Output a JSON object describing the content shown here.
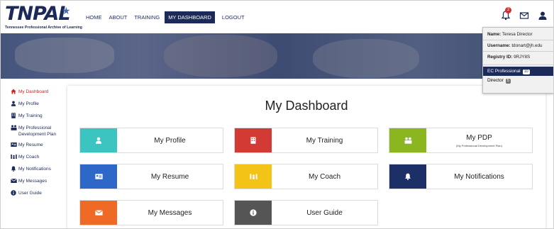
{
  "header": {
    "logo_text": "TNPAL",
    "logo_subtitle": "Tennessee Professional Archive of Learning",
    "nav": [
      {
        "label": "HOME"
      },
      {
        "label": "ABOUT"
      },
      {
        "label": "TRAINING"
      },
      {
        "label": "MY DASHBOARD",
        "active": true
      },
      {
        "label": "LOGOUT"
      }
    ],
    "notification_count": "2",
    "icons": [
      "bell-icon",
      "mail-icon",
      "user-icon"
    ]
  },
  "user_menu": {
    "name_label": "Name:",
    "name_value": "Teresa Director",
    "username_label": "Username:",
    "username_value": "tdonart@jh.edu",
    "registry_label": "Registry ID:",
    "registry_value": "9RJY8S",
    "roles": [
      {
        "label": "EC Professional",
        "count": "10",
        "active": true
      },
      {
        "label": "Director",
        "count": "5",
        "active": false
      }
    ]
  },
  "sidebar": {
    "items": [
      {
        "label": "My Dashboard",
        "icon": "home-icon",
        "active": true
      },
      {
        "label": "My Profile",
        "icon": "person-icon"
      },
      {
        "label": "My Training",
        "icon": "building-icon"
      },
      {
        "label": "My Professional Development Plan",
        "icon": "people-icon"
      },
      {
        "label": "My Resume",
        "icon": "id-card-icon"
      },
      {
        "label": "My Coach",
        "icon": "coach-icon"
      },
      {
        "label": "My Notifications",
        "icon": "bell-icon"
      },
      {
        "label": "My Messages",
        "icon": "envelope-icon"
      },
      {
        "label": "User Guide",
        "icon": "info-icon"
      }
    ]
  },
  "main": {
    "title": "My Dashboard",
    "tiles": [
      {
        "label": "My Profile",
        "sub": "",
        "color": "#3cc4c1",
        "icon": "person-icon"
      },
      {
        "label": "My Training",
        "sub": "",
        "color": "#d23b33",
        "icon": "building-icon"
      },
      {
        "label": "My PDP",
        "sub": "(My Professional Development Plan)",
        "color": "#8cb61f",
        "icon": "people-icon"
      },
      {
        "label": "My Resume",
        "sub": "",
        "color": "#2d67c7",
        "icon": "id-card-icon"
      },
      {
        "label": "My Coach",
        "sub": "",
        "color": "#f3c417",
        "icon": "coach-icon"
      },
      {
        "label": "My Notifications",
        "sub": "",
        "color": "#1c2f66",
        "icon": "bell-icon"
      },
      {
        "label": "My Messages",
        "sub": "",
        "color": "#ee6a25",
        "icon": "envelope-icon"
      },
      {
        "label": "User Guide",
        "sub": "",
        "color": "#555555",
        "icon": "info-icon"
      }
    ]
  }
}
